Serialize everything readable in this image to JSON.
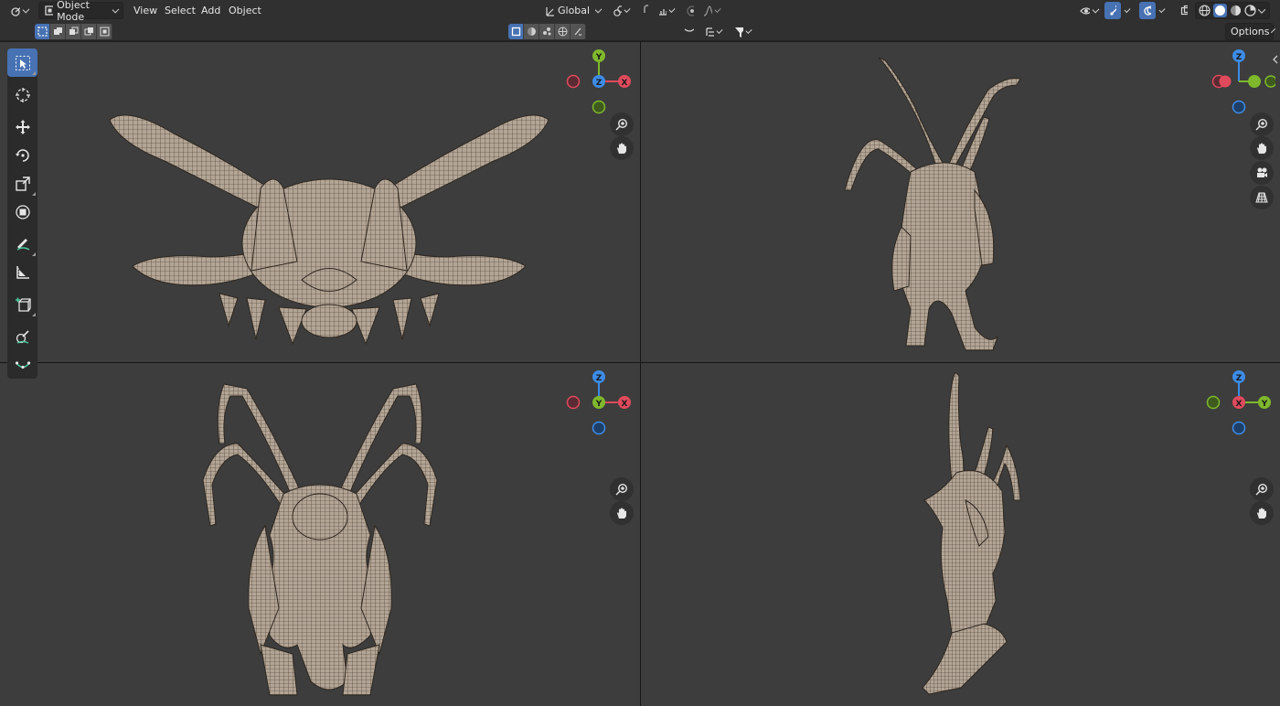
{
  "header": {
    "editor_type_icon": "3d-viewport-icon",
    "mode": {
      "label": "Object Mode",
      "icon": "object-mode-icon"
    },
    "menus": [
      "View",
      "Select",
      "Add",
      "Object"
    ],
    "transform_orientation": "Global",
    "pivot_icon": "pivot-icon",
    "snap_icon": "snap-magnet-icon",
    "proportional_icon": "proportional-edit-icon",
    "options_label": "Options"
  },
  "toolrow": {
    "select_modes": [
      "new",
      "extend",
      "subtract",
      "invert",
      "intersect"
    ],
    "search_placeholder": ""
  },
  "tools": [
    {
      "name": "select-box",
      "icon": "cursor-select-icon",
      "active": true
    },
    {
      "name": "cursor",
      "icon": "3d-cursor-icon",
      "active": false
    },
    {
      "name": "move",
      "icon": "move-icon",
      "active": false
    },
    {
      "name": "rotate",
      "icon": "rotate-icon",
      "active": false
    },
    {
      "name": "scale",
      "icon": "scale-icon",
      "active": false
    },
    {
      "name": "transform",
      "icon": "transform-icon",
      "active": false
    },
    {
      "name": "annotate",
      "icon": "annotate-icon",
      "active": false
    },
    {
      "name": "measure",
      "icon": "measure-icon",
      "active": false
    },
    {
      "name": "add-cube",
      "icon": "add-cube-icon",
      "active": false
    },
    {
      "name": "sculpt-brush",
      "icon": "brush-icon",
      "active": false
    },
    {
      "name": "curve",
      "icon": "curve-icon",
      "active": false
    }
  ],
  "viewports": {
    "top_left": {
      "view": "top",
      "axes": [
        "Y",
        "X",
        "Z"
      ]
    },
    "top_right": {
      "view": "perspective",
      "axes": [
        "Z"
      ]
    },
    "bottom_left": {
      "view": "front",
      "axes": [
        "Z",
        "X",
        "Y"
      ]
    },
    "bottom_right": {
      "view": "right",
      "axes": [
        "Z",
        "Y",
        "X"
      ]
    }
  },
  "colors": {
    "accent": "#4772b3",
    "axis_x": "#e04a5c",
    "axis_y": "#7fb82c",
    "axis_z": "#3d8ce8",
    "mesh": "#b6a898",
    "viewport_bg": "#3d3d3d"
  }
}
